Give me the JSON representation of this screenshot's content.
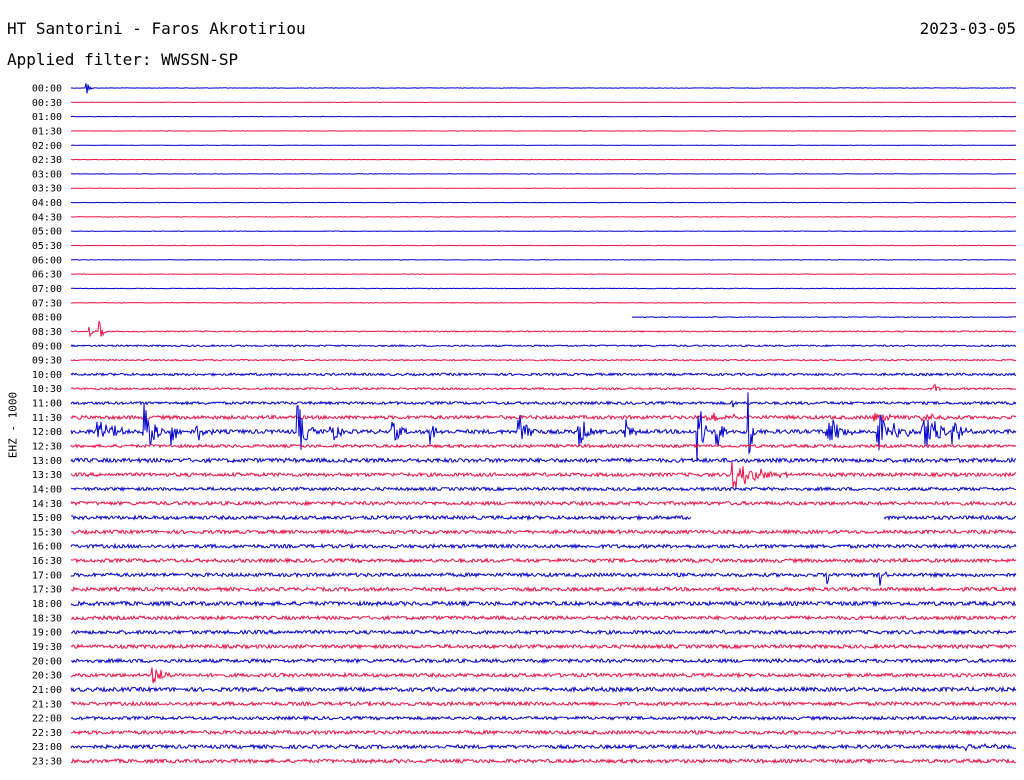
{
  "header": {
    "station": "HT Santorini - Faros Akrotiriou",
    "date": "2023-03-05",
    "filter": "Applied filter: WWSSN-SP",
    "channel": "EHZ - 1000"
  },
  "chart_data": {
    "type": "helicorder",
    "title": "HT Santorini - Faros Akrotiriou",
    "date": "2023-03-05",
    "filter": "WWSSN-SP",
    "ylabel": "EHZ - 1000",
    "row_minutes": 30,
    "trace_colors": [
      "#0000cc",
      "#ee1144"
    ],
    "rows": [
      "00:00",
      "00:30",
      "01:00",
      "01:30",
      "02:00",
      "02:30",
      "03:00",
      "03:30",
      "04:00",
      "04:30",
      "05:00",
      "05:30",
      "06:00",
      "06:30",
      "07:00",
      "07:30",
      "08:00",
      "08:30",
      "09:00",
      "09:30",
      "10:00",
      "10:30",
      "11:00",
      "11:30",
      "12:00",
      "12:30",
      "13:00",
      "13:30",
      "14:00",
      "14:30",
      "15:00",
      "15:30",
      "16:00",
      "16:30",
      "17:00",
      "17:30",
      "18:00",
      "18:30",
      "19:00",
      "19:30",
      "20:00",
      "20:30",
      "21:00",
      "21:30",
      "22:00",
      "22:30",
      "23:00",
      "23:30"
    ],
    "noise_levels": [
      0.2,
      0.2,
      0.2,
      0.2,
      0.2,
      0.2,
      0.2,
      0.2,
      0.2,
      0.25,
      0.25,
      0.25,
      0.25,
      0.25,
      0.3,
      0.3,
      0.4,
      0.6,
      0.8,
      0.7,
      1.2,
      1.0,
      1.4,
      1.8,
      2.0,
      1.5,
      2.0,
      1.8,
      1.6,
      1.8,
      1.8,
      1.8,
      1.8,
      1.8,
      1.8,
      1.8,
      2.0,
      1.8,
      1.8,
      1.8,
      1.8,
      1.8,
      2.0,
      1.8,
      1.6,
      1.8,
      1.8,
      1.8
    ],
    "events": [
      {
        "row": "00:00",
        "minute": 0.5,
        "amplitude": 8,
        "duration_min": 0.2
      },
      {
        "row": "08:30",
        "minute": 0.6,
        "amplitude": 6,
        "duration_min": 0.2
      },
      {
        "row": "08:30",
        "minute": 0.9,
        "amplitude": 14,
        "duration_min": 0.2
      },
      {
        "row": "10:30",
        "minute": 27.4,
        "amplitude": 6,
        "duration_min": 0.2
      },
      {
        "row": "11:00",
        "minute": 21.0,
        "amplitude": 5,
        "duration_min": 0.2
      },
      {
        "row": "11:30",
        "minute": 20.2,
        "amplitude": 6,
        "duration_min": 1.5
      },
      {
        "row": "11:30",
        "minute": 25.5,
        "amplitude": 6,
        "duration_min": 1.2
      },
      {
        "row": "11:30",
        "minute": 27.0,
        "amplitude": 5,
        "duration_min": 1.0
      },
      {
        "row": "12:00",
        "minute": 0.8,
        "amplitude": 16,
        "duration_min": 1.2
      },
      {
        "row": "12:00",
        "minute": 2.3,
        "amplitude": 28,
        "duration_min": 0.8
      },
      {
        "row": "12:00",
        "minute": 3.2,
        "amplitude": 14,
        "duration_min": 0.4
      },
      {
        "row": "12:00",
        "minute": 4.0,
        "amplitude": 10,
        "duration_min": 0.6
      },
      {
        "row": "12:00",
        "minute": 7.2,
        "amplitude": 30,
        "duration_min": 0.6
      },
      {
        "row": "12:00",
        "minute": 8.2,
        "amplitude": 18,
        "duration_min": 0.5
      },
      {
        "row": "12:00",
        "minute": 10.2,
        "amplitude": 14,
        "duration_min": 0.5
      },
      {
        "row": "12:00",
        "minute": 11.4,
        "amplitude": 16,
        "duration_min": 0.4
      },
      {
        "row": "12:00",
        "minute": 14.2,
        "amplitude": 25,
        "duration_min": 0.6
      },
      {
        "row": "12:00",
        "minute": 16.1,
        "amplitude": 22,
        "duration_min": 0.6
      },
      {
        "row": "12:00",
        "minute": 17.6,
        "amplitude": 16,
        "duration_min": 0.4
      },
      {
        "row": "12:00",
        "minute": 19.9,
        "amplitude": 40,
        "duration_min": 0.4
      },
      {
        "row": "12:00",
        "minute": 20.5,
        "amplitude": 20,
        "duration_min": 0.4
      },
      {
        "row": "12:00",
        "minute": 21.5,
        "amplitude": 40,
        "duration_min": 0.3
      },
      {
        "row": "12:00",
        "minute": 24.0,
        "amplitude": 18,
        "duration_min": 1.0
      },
      {
        "row": "12:00",
        "minute": 25.6,
        "amplitude": 22,
        "duration_min": 1.2
      },
      {
        "row": "12:00",
        "minute": 27.0,
        "amplitude": 24,
        "duration_min": 1.2
      },
      {
        "row": "12:00",
        "minute": 28.0,
        "amplitude": 14,
        "duration_min": 0.6
      },
      {
        "row": "13:30",
        "minute": 21.0,
        "amplitude": 16,
        "duration_min": 1.8
      },
      {
        "row": "17:00",
        "minute": 24.0,
        "amplitude": 14,
        "duration_min": 0.2
      },
      {
        "row": "17:00",
        "minute": 25.7,
        "amplitude": 14,
        "duration_min": 0.2
      },
      {
        "row": "20:30",
        "minute": 2.6,
        "amplitude": 10,
        "duration_min": 0.8
      },
      {
        "row": "23:00",
        "minute": 28.4,
        "amplitude": 6,
        "duration_min": 1.2
      }
    ],
    "gaps": [
      {
        "row": "08:00",
        "from_minute": 0,
        "to_minute": 17.8
      },
      {
        "row": "15:00",
        "from_minute": 19.7,
        "to_minute": 25.8
      }
    ],
    "grid": false,
    "legend": "none"
  }
}
